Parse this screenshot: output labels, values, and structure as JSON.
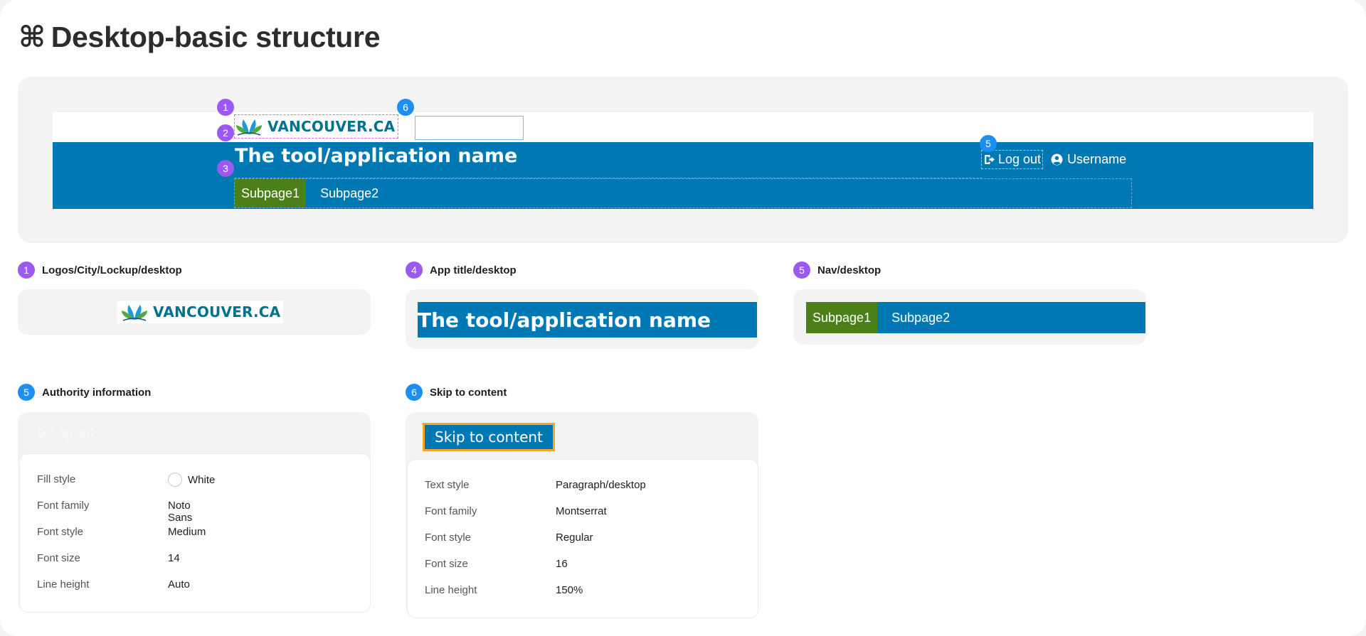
{
  "page": {
    "title": "Desktop-basic structure",
    "title_icon": "command-icon",
    "title_icon_glyph": "⌘"
  },
  "preview": {
    "logo_text": "VANCOUVER.CA",
    "app_title": "The tool/application name",
    "logout_label": "Log out",
    "username_label": "Username",
    "nav": [
      "Subpage1",
      "Subpage2"
    ],
    "markers": [
      "1",
      "6",
      "2",
      "3",
      "5"
    ]
  },
  "sections": {
    "logos": {
      "badge": "1",
      "title": "Logos/City/Lockup/desktop",
      "logo_text": "VANCOUVER.CA"
    },
    "app_title": {
      "badge": "4",
      "title": "App title/desktop",
      "bar_text": "The tool/application name"
    },
    "nav": {
      "badge": "5",
      "title": "Nav/desktop",
      "items": [
        "Subpage1",
        "Subpage2"
      ]
    },
    "authority": {
      "badge": "5",
      "title": "Authority information",
      "ghost_logout": "Log out",
      "props": [
        {
          "label": "Fill style",
          "value": "White"
        },
        {
          "label": "Font family",
          "value": "Noto Sans"
        },
        {
          "label": "Font style",
          "value": "Medium"
        },
        {
          "label": "Font size",
          "value": "14"
        },
        {
          "label": "Line height",
          "value": "Auto"
        }
      ]
    },
    "skip": {
      "badge": "6",
      "title": "Skip to content",
      "button_label": "Skip to content",
      "props": [
        {
          "label": "Text style",
          "value": "Paragraph/desktop"
        },
        {
          "label": "Font family",
          "value": "Montserrat"
        },
        {
          "label": "Font style",
          "value": "Regular"
        },
        {
          "label": "Font size",
          "value": "16"
        },
        {
          "label": "Line height",
          "value": "150%"
        }
      ]
    }
  },
  "colors": {
    "brand_blue": "#0078b3",
    "nav_active_green": "#4b7f17",
    "badge_purple": "#9b59f2",
    "badge_blue": "#1d8ff2",
    "focus_orange": "#f5a623",
    "logo_teal": "#00728f"
  }
}
